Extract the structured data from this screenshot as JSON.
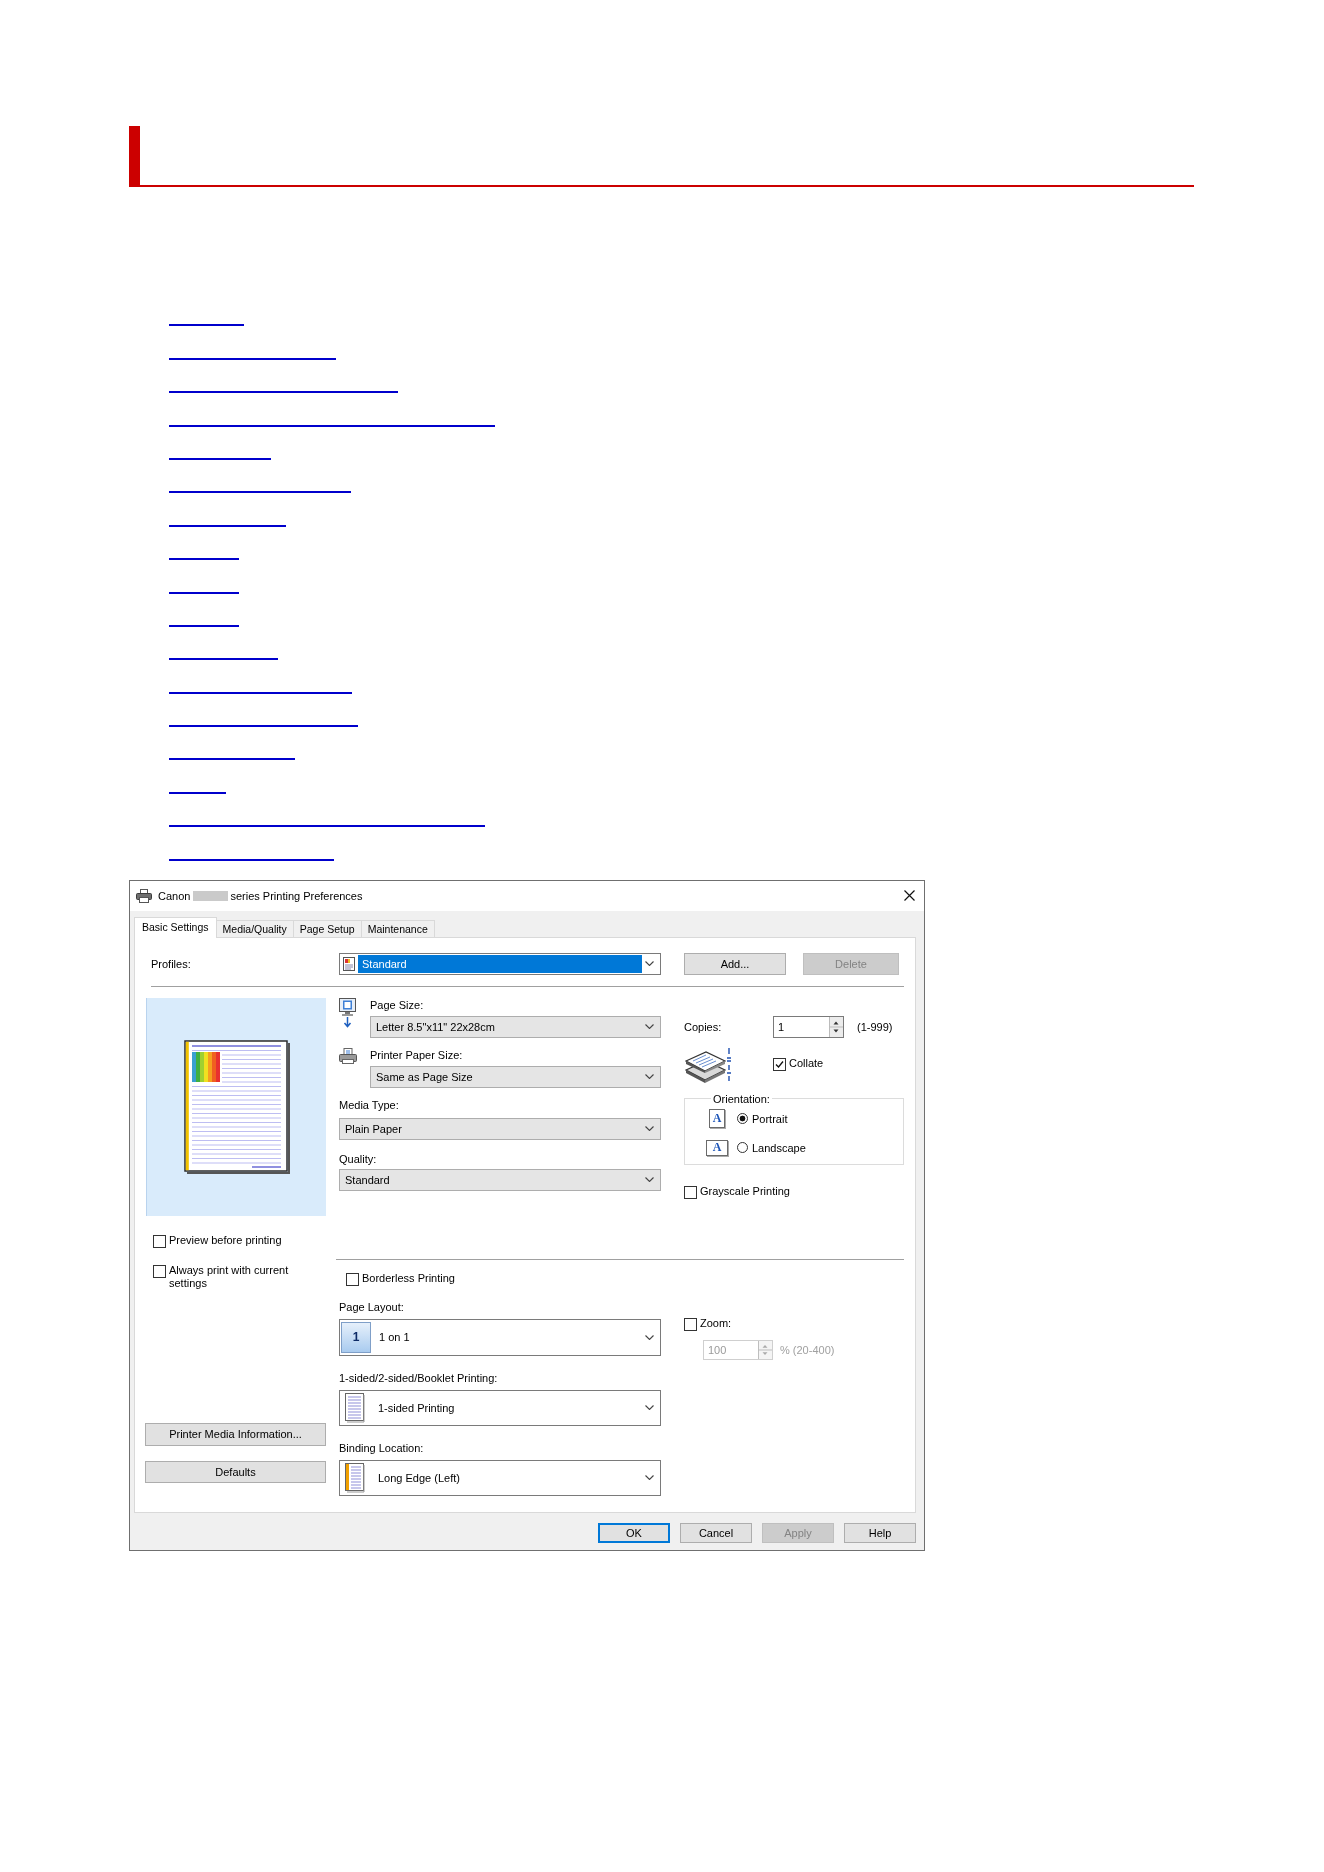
{
  "links": [
    {
      "kind": "underline"
    },
    {
      "kind": "underline"
    },
    {
      "kind": "underline"
    },
    {
      "kind": "underline"
    },
    {
      "kind": "underline"
    },
    {
      "kind": "underline"
    },
    {
      "kind": "underline"
    },
    {
      "kind": "underline"
    },
    {
      "kind": "underline"
    },
    {
      "kind": "underline"
    },
    {
      "kind": "underline"
    },
    {
      "kind": "underline"
    },
    {
      "kind": "underline"
    },
    {
      "kind": "underline"
    },
    {
      "kind": "underline"
    },
    {
      "kind": "underline"
    },
    {
      "kind": "underline"
    }
  ],
  "dialog": {
    "title": {
      "start": "Canon",
      "redacted": true,
      "end": "series Printing Preferences"
    },
    "tabs": [
      {
        "label": "Basic Settings",
        "selected": true
      },
      {
        "label": "Media/Quality",
        "selected": false
      },
      {
        "label": "Page Setup",
        "selected": false
      },
      {
        "label": "Maintenance",
        "selected": false
      }
    ],
    "profiles": {
      "label": "Profiles:",
      "value": "Standard",
      "highlighted": true
    },
    "profile_buttons": [
      {
        "label": "Add...",
        "disabled": false
      },
      {
        "label": "Delete",
        "disabled": true
      }
    ],
    "preview_options": [
      {
        "label": "Preview before printing",
        "checked": false
      },
      {
        "label": "Always print with current settings",
        "checked": false
      }
    ],
    "side_buttons": [
      "Printer Media Information...",
      "Defaults"
    ],
    "page_size": {
      "label": "Page Size:",
      "value": "Letter 8.5\"x11\" 22x28cm"
    },
    "printer_paper_size": {
      "label": "Printer Paper Size:",
      "value": "Same as Page Size"
    },
    "media_type": {
      "label": "Media Type:",
      "value": "Plain Paper"
    },
    "quality": {
      "label": "Quality:",
      "value": "Standard"
    },
    "copies": {
      "label": "Copies:",
      "value": "1",
      "range": "(1-999)"
    },
    "collate": {
      "label": "Collate",
      "checked": true
    },
    "orientation": {
      "title": "Orientation:",
      "options": [
        {
          "kind": "portrait",
          "icon_letter": "A",
          "label": "Portrait",
          "selected": true
        },
        {
          "kind": "landscape",
          "icon_letter": "A",
          "label": "Landscape",
          "selected": false
        }
      ]
    },
    "grayscale": {
      "label": "Grayscale Printing",
      "checked": false
    },
    "borderless": {
      "label": "Borderless Printing",
      "checked": false
    },
    "page_layout": {
      "label": "Page Layout:",
      "icon_text": "1",
      "value": "1 on 1"
    },
    "zoom": {
      "label": "Zoom:",
      "checked": false,
      "value": "100",
      "range": "% (20-400)",
      "disabled": true
    },
    "duplex": {
      "label": "1-sided/2-sided/Booklet Printing:",
      "value": "1-sided Printing"
    },
    "binding": {
      "label": "Binding Location:",
      "value": "Long Edge (Left)"
    },
    "footer_buttons": [
      {
        "label": "OK",
        "default": true,
        "disabled": false
      },
      {
        "label": "Cancel",
        "default": false,
        "disabled": false
      },
      {
        "label": "Apply",
        "default": false,
        "disabled": true
      },
      {
        "label": "Help",
        "default": false,
        "disabled": false
      }
    ]
  }
}
